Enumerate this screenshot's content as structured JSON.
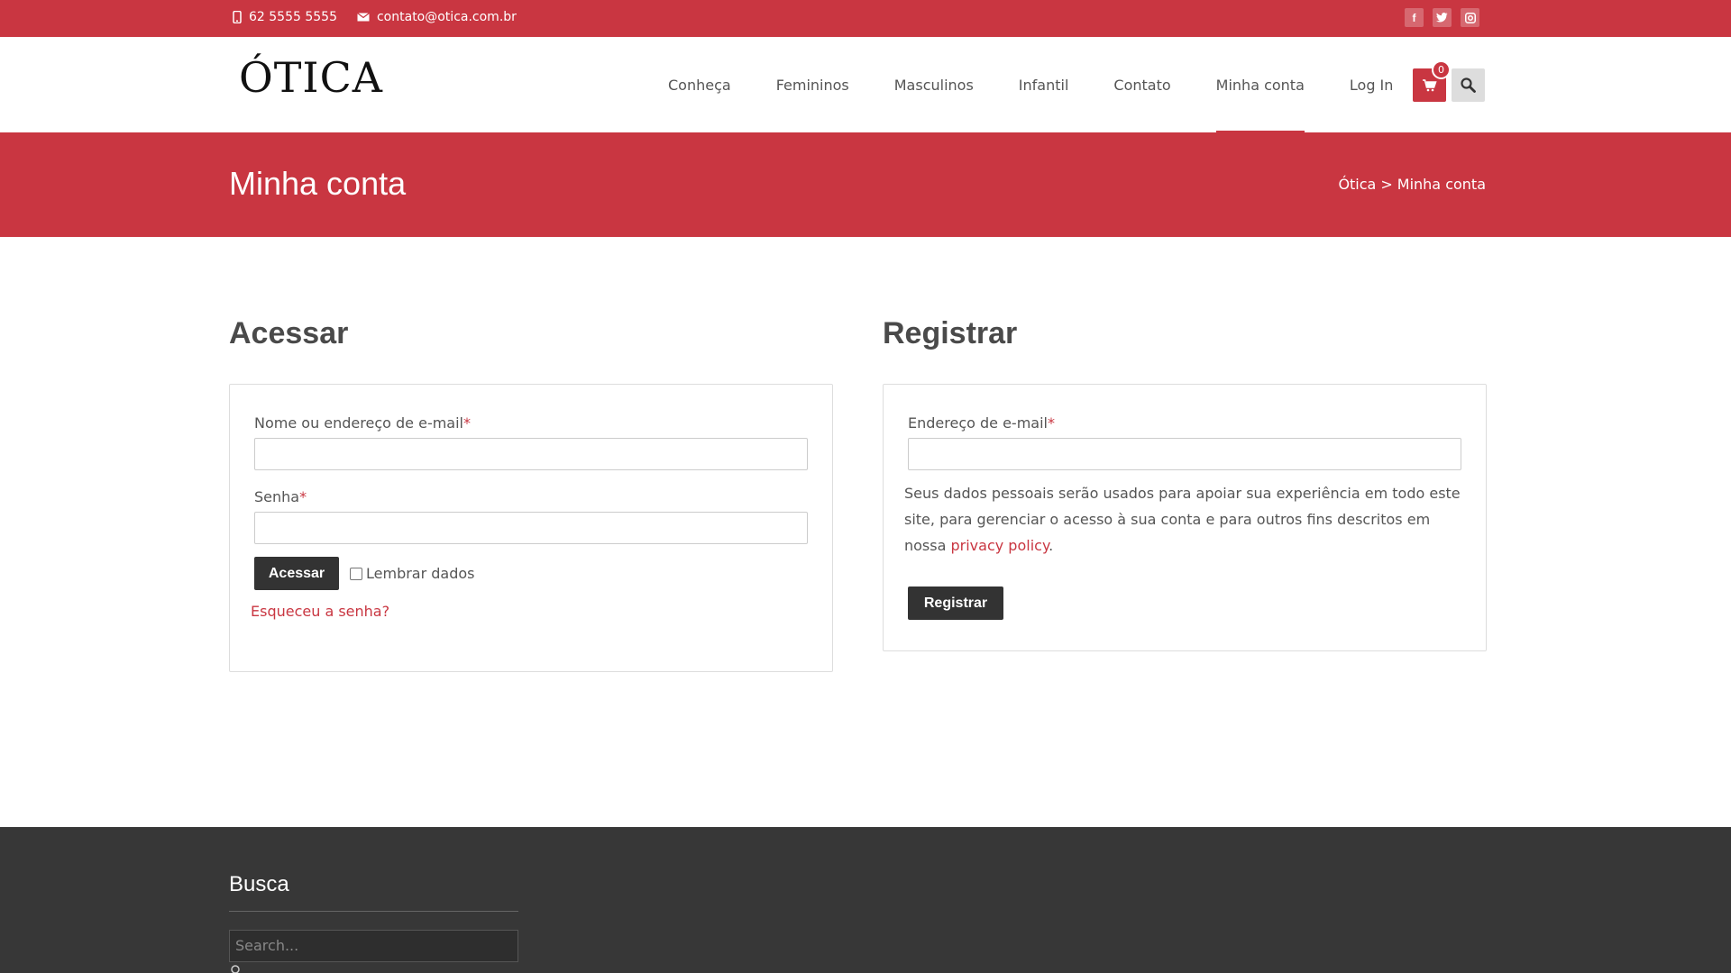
{
  "topbar": {
    "phone": "62 5555 5555",
    "email": "contato@otica.com.br",
    "social": [
      "facebook-icon",
      "twitter-icon",
      "instagram-icon"
    ]
  },
  "header": {
    "logo": "ÓTICA",
    "nav": [
      {
        "label": "Conheça",
        "active": false
      },
      {
        "label": "Femininos",
        "active": false
      },
      {
        "label": "Masculinos",
        "active": false
      },
      {
        "label": "Infantil",
        "active": false
      },
      {
        "label": "Contato",
        "active": false
      },
      {
        "label": "Minha conta",
        "active": true
      },
      {
        "label": "Log In",
        "active": false
      }
    ],
    "cart_count": "0"
  },
  "page": {
    "title": "Minha conta",
    "breadcrumb": {
      "home": "Ótica",
      "separator": ">",
      "current": "Minha conta"
    }
  },
  "login": {
    "title": "Acessar",
    "username_label": "Nome ou endereço de e-mail",
    "password_label": "Senha",
    "required_mark": "*",
    "submit": "Acessar",
    "remember": "Lembrar dados",
    "lost_password": "Esqueceu a senha?"
  },
  "register": {
    "title": "Registrar",
    "email_label": "Endereço de e-mail",
    "required_mark": "*",
    "privacy_text": "Seus dados pessoais serão usados para apoiar sua experiência em todo este site, para gerenciar o acesso à sua conta e para outros fins descritos em nossa ",
    "privacy_link": "privacy policy",
    "privacy_end": ".",
    "submit": "Registrar"
  },
  "footer": {
    "widget_title": "Busca",
    "search_placeholder": "Search..."
  },
  "colors": {
    "brand": "#c93641",
    "dark": "#333333",
    "footer": "#373737"
  }
}
